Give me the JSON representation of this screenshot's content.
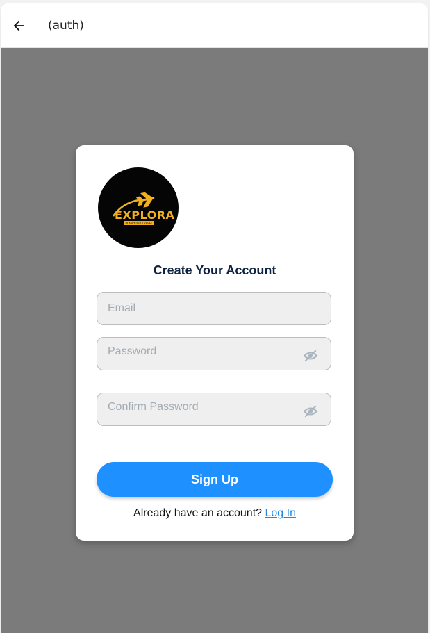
{
  "header": {
    "title": "(auth)",
    "back_icon": "arrow-left-icon"
  },
  "logo": {
    "text": "EXPLORA",
    "tagline": "PLAN YOUR TRAVEL",
    "icon": "airplane-icon",
    "colors": {
      "background": "#050505",
      "accent": "#f2b01e"
    }
  },
  "form": {
    "title": "Create Your Account",
    "email": {
      "placeholder": "Email",
      "value": ""
    },
    "password": {
      "placeholder": "Password",
      "value": "",
      "icon": "eye-off-icon"
    },
    "confirm_password": {
      "placeholder": "Confirm Password",
      "value": "",
      "icon": "eye-off-icon"
    },
    "submit_label": "Sign Up",
    "login_prompt": "Already have an account?",
    "login_link": "Log In"
  },
  "colors": {
    "backdrop": "#7b7b7b",
    "primary": "#1e90ff",
    "link": "#1e88e5",
    "title": "#0d2240"
  }
}
